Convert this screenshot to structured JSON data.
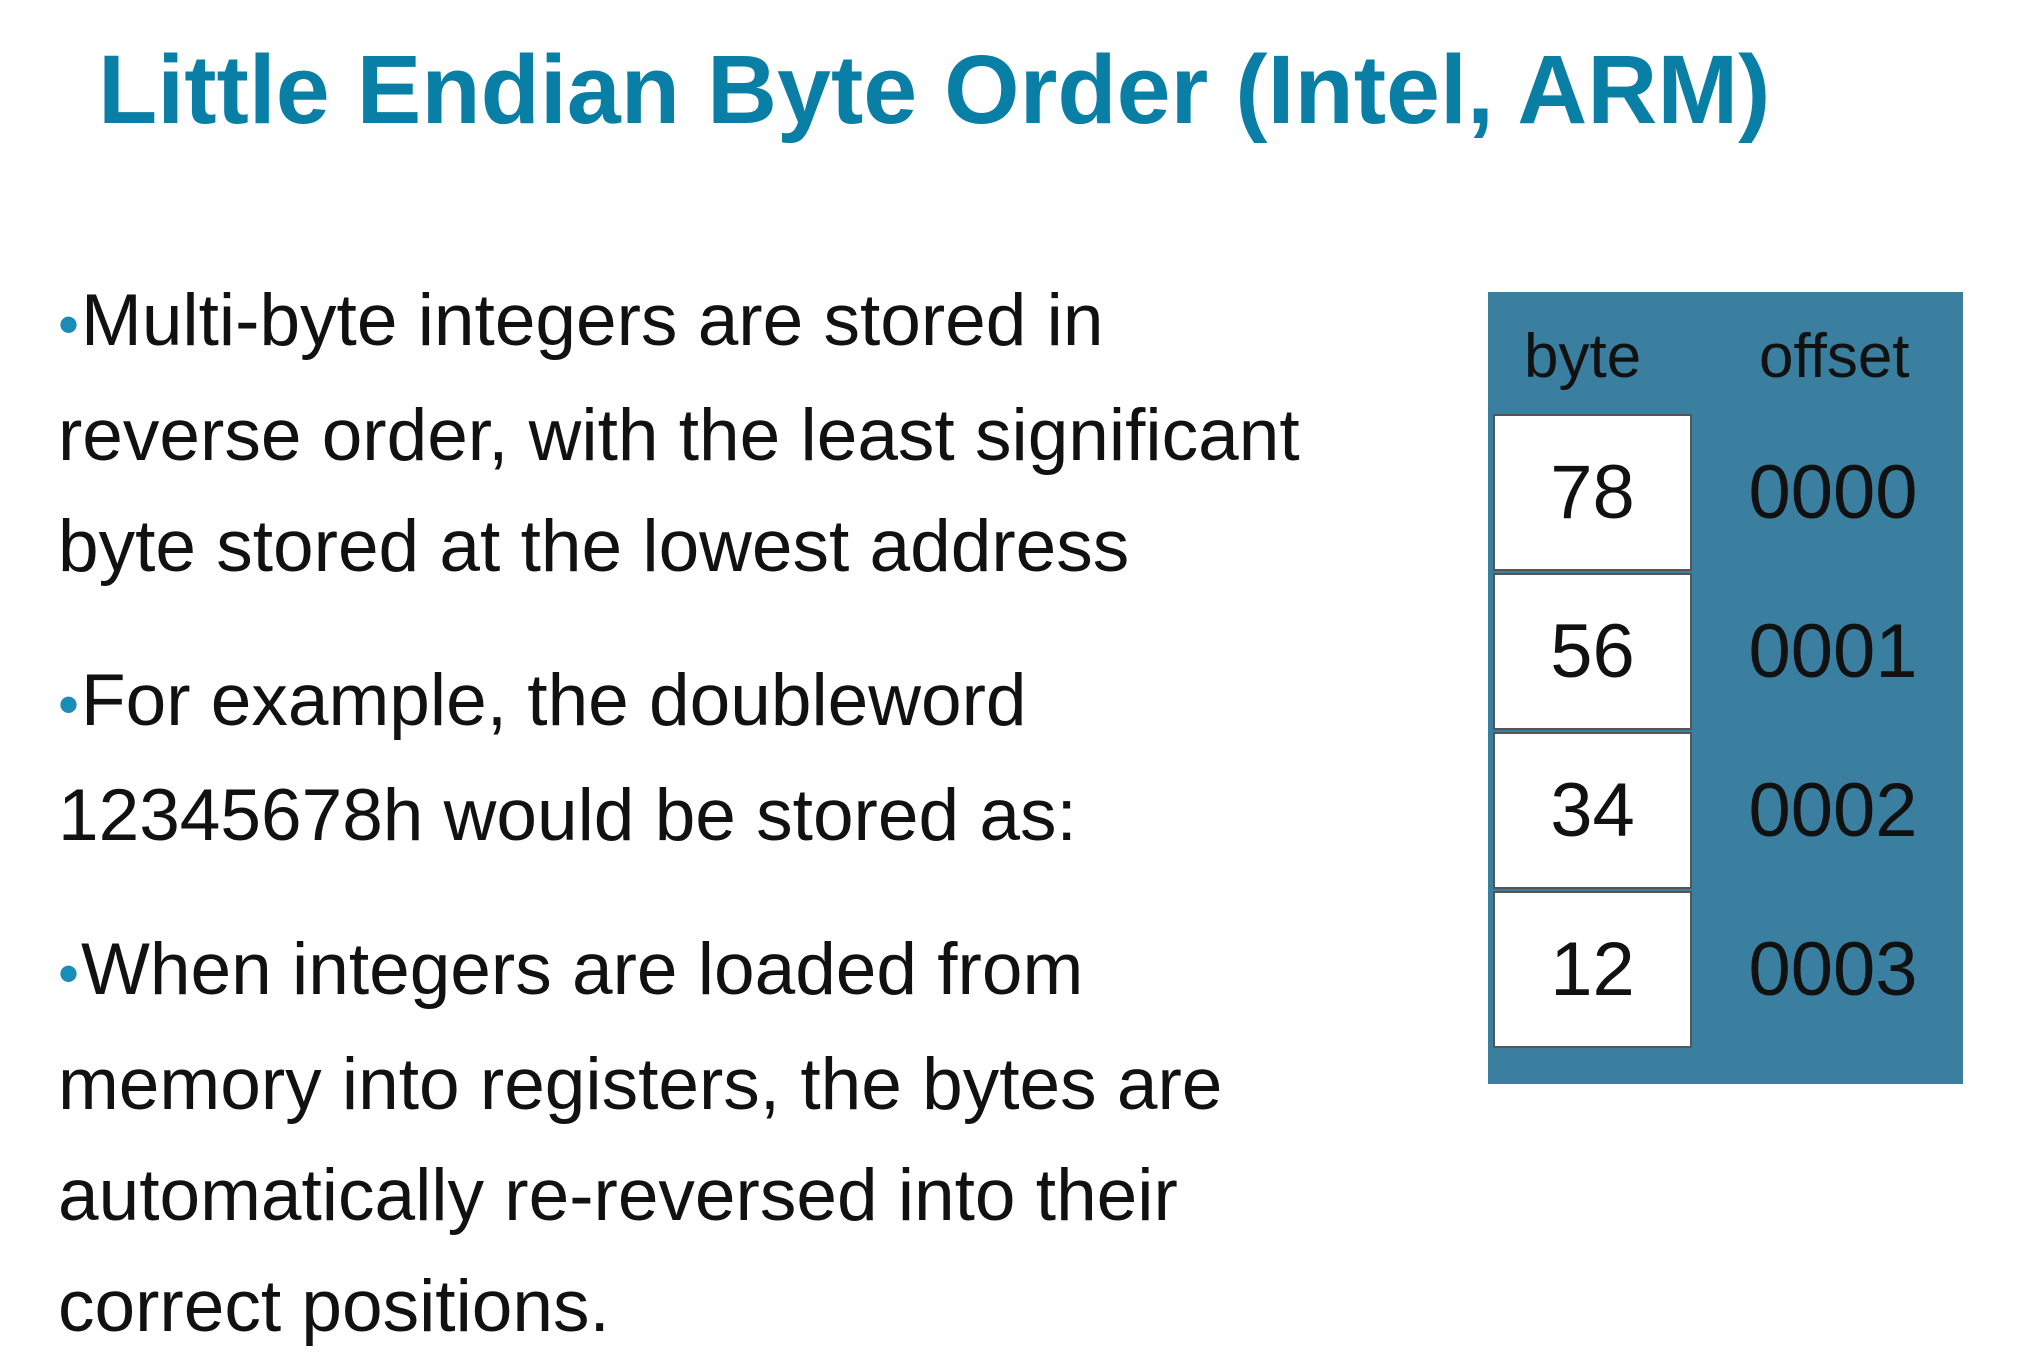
{
  "title": "Little Endian Byte Order (Intel, ARM)",
  "bullet_marker": "•",
  "bullets": [
    "Multi-byte integers are stored in\nreverse order, with the least significant\nbyte stored at the lowest address",
    "For example, the doubleword\n12345678h would be stored as:",
    "When integers are loaded from\nmemory into registers, the bytes are\nautomatically re-reversed into their\ncorrect positions."
  ],
  "memory_table": {
    "header_byte": "byte",
    "header_offset": "offset",
    "rows": [
      {
        "byte": "78",
        "offset": "0000"
      },
      {
        "byte": "56",
        "offset": "0001"
      },
      {
        "byte": "34",
        "offset": "0002"
      },
      {
        "byte": "12",
        "offset": "0003"
      }
    ],
    "panel_color": "#3a7fa0"
  },
  "colors": {
    "title": "#0a7fa5",
    "bullet_marker": "#1a8cb8",
    "text": "#111111"
  }
}
